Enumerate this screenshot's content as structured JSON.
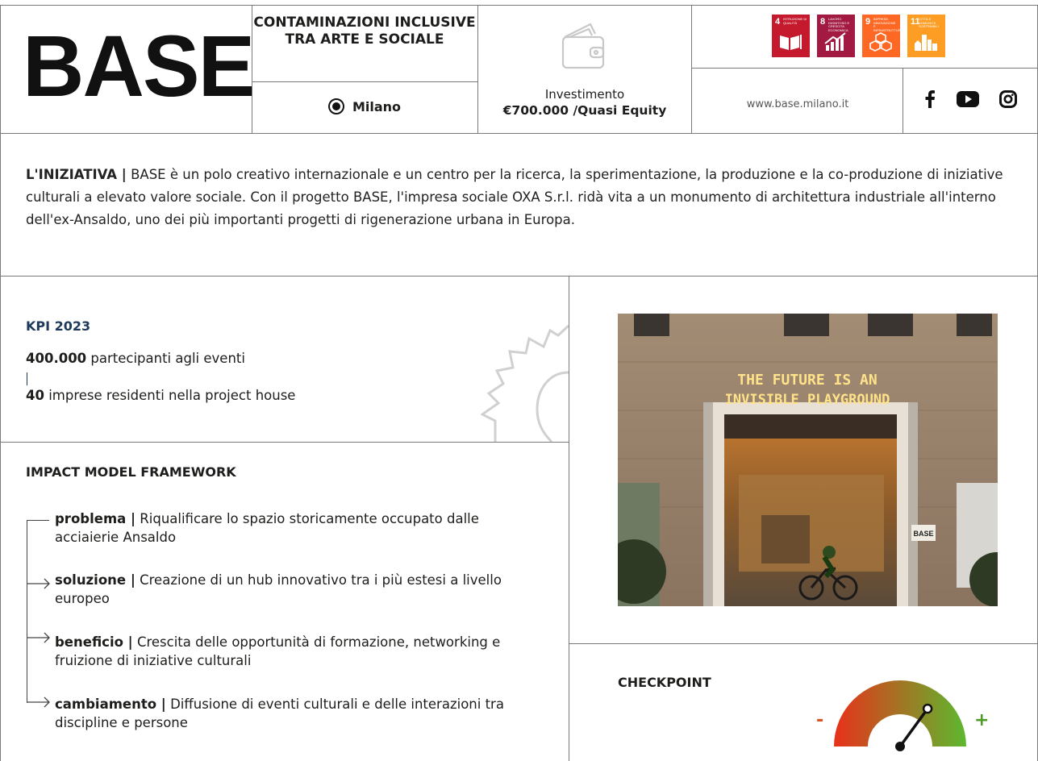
{
  "header": {
    "logo": "BASE",
    "title": "CONTAMINAZIONI INCLUSIVE TRA ARTE E SOCIALE",
    "city": "Milano",
    "invest_label": "Investimento",
    "invest_value": "€700.000 /Quasi Equity",
    "website": "www.base.milano.it",
    "sdgs": [
      {
        "number": "4",
        "label": "Istruzione di qualità",
        "color": "#C5192D",
        "icon": "book-icon"
      },
      {
        "number": "8",
        "label": "Lavoro dignitoso e crescita economica",
        "color": "#A21942",
        "icon": "growth-chart-icon"
      },
      {
        "number": "9",
        "label": "Imprese, innovazione e infrastrutture",
        "color": "#FD6925",
        "icon": "cubes-icon"
      },
      {
        "number": "11",
        "label": "Città e comunità sostenibili",
        "color": "#FD9D24",
        "icon": "buildings-icon"
      }
    ],
    "socials": [
      "facebook-icon",
      "youtube-icon",
      "instagram-icon"
    ]
  },
  "intro": {
    "label": "L'INIZIATIVA |",
    "text": " BASE è un polo creativo internazionale e un centro per la ricerca, la sperimentazione, la produzione e la co-produzione di iniziative culturali a elevato valore sociale. Con il progetto BASE, l'impresa sociale OXA S.r.l. ridà vita a un monumento di architettura industriale all'interno dell'ex-Ansaldo, uno dei più importanti progetti di rigenerazione urbana in Europa."
  },
  "kpi": {
    "title": "KPI 2023",
    "items": [
      {
        "value": "400.000",
        "label": " partecipanti agli eventi"
      },
      {
        "value": "40",
        "label": " imprese residenti nella project house"
      }
    ],
    "separator": "|"
  },
  "framework": {
    "title": "IMPACT MODEL FRAMEWORK",
    "items": [
      {
        "key": "problema |",
        "text": " Riqualificare lo spazio storicamente occupato dalle acciaierie Ansaldo"
      },
      {
        "key": "soluzione |",
        "text": " Creazione di un hub innovativo tra i più estesi a livello europeo"
      },
      {
        "key": "beneficio |",
        "text": " Crescita delle opportunità di formazione, networking e fruizione di iniziative culturali"
      },
      {
        "key": "cambiamento |",
        "text": " Diffusione di eventi culturali e delle interazioni tra discipline e persone"
      }
    ]
  },
  "photo": {
    "sign": "THE FUTURE IS AN INVISIBLE PLAYGROUND",
    "door_label": "BASE"
  },
  "checkpoint": {
    "title": "CHECKPOINT",
    "minus": "-",
    "plus": "+",
    "level": 0.7,
    "colors": {
      "low": "#E8311A",
      "high": "#5DB82F"
    }
  }
}
